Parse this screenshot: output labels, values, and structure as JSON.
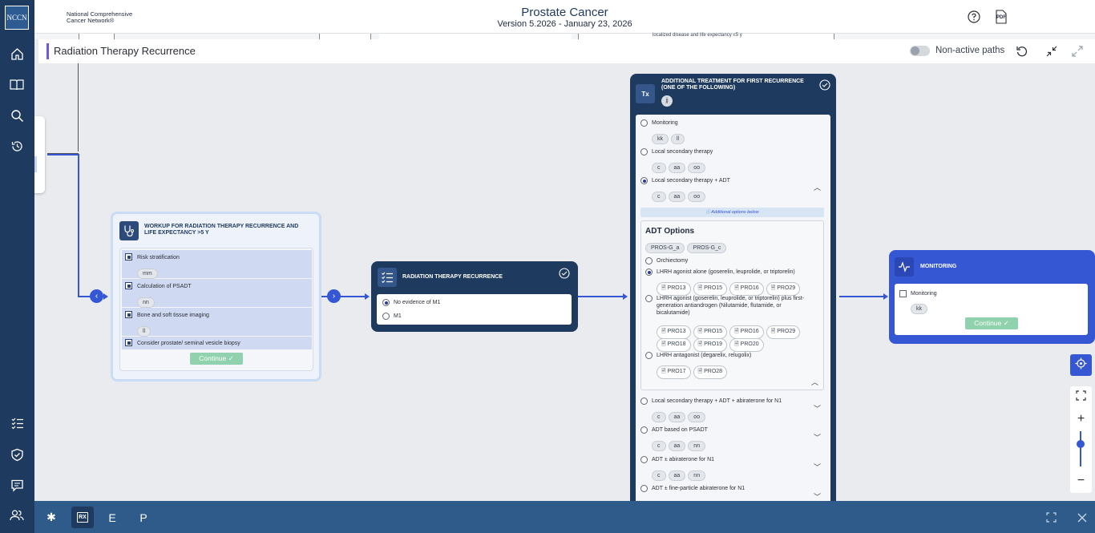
{
  "org": {
    "logo_text": "NCCN",
    "name": "National Comprehensive\nCancer Network®"
  },
  "header": {
    "title": "Prostate Cancer",
    "version": "Version 5.2026 - January 23, 2026",
    "pdf_label": "PDF"
  },
  "background_text": "localized disease and life expectancy ≤5 y",
  "toolbar": {
    "title": "Radiation Therapy Recurrence",
    "nonactive_label": "Non-active paths"
  },
  "workup": {
    "title": "Workup for radiation therapy recurrence and life expectancy >5 y",
    "items": [
      {
        "label": "Risk stratification",
        "chips": [
          "mm"
        ]
      },
      {
        "label": "Calculation of PSADT",
        "chips": [
          "nn"
        ]
      },
      {
        "label": "Bone and soft tissue imaging",
        "chips": [
          "ll"
        ]
      },
      {
        "label": "Consider prostate/ seminal vesicle biopsy",
        "chips": []
      }
    ],
    "continue_label": "Continue ✓"
  },
  "rtr": {
    "title": "Radiation therapy recurrence",
    "options": [
      {
        "label": "No evidence of M1",
        "selected": true
      },
      {
        "label": "M1",
        "selected": false
      }
    ]
  },
  "additional": {
    "title": "Additional treatment for first recurrence (one of the following)",
    "badge": "jj",
    "options": [
      {
        "label": "Monitoring",
        "chips": [
          "kk",
          "ll"
        ]
      },
      {
        "label": "Local secondary therapy",
        "chips": [
          "c",
          "aa",
          "oo"
        ]
      },
      {
        "label": "Local secondary therapy + ADT",
        "chips": [
          "c",
          "aa",
          "oo"
        ]
      }
    ],
    "notice": "Additional options below",
    "adt": {
      "title": "ADT Options",
      "chips": [
        "PROS-G_a",
        "PROS-G_c"
      ],
      "options": [
        {
          "label": "Orchiectomy"
        },
        {
          "label": "LHRH agonist alone (goserelin, leuprolide, or triptorelin)",
          "docs": [
            "PRO13",
            "PRO15",
            "PRO16",
            "PRO29"
          ]
        },
        {
          "label": "LHRH agonist (goserelin, leuprolide, or triptorelin) plus first-generation antiandrogen (Nilutamide, flutamide, or bicalutamide)",
          "docs": [
            "PRO13",
            "PRO15",
            "PRO16",
            "PRO29",
            "PRO18",
            "PRO19",
            "PRO20"
          ]
        },
        {
          "label": "LHRH antagonist (degarelix, relugolix)",
          "docs": [
            "PRO17",
            "PRO28"
          ]
        }
      ]
    },
    "more": [
      {
        "label": "Local secondary therapy + ADT + abiraterone for N1",
        "chips": [
          "c",
          "aa",
          "oo"
        ]
      },
      {
        "label": "ADT based on PSADT",
        "chips": [
          "c",
          "aa",
          "nn"
        ]
      },
      {
        "label": "ADT ± abiraterone for N1",
        "chips": [
          "c",
          "aa",
          "nn"
        ]
      },
      {
        "label": "ADT ± fine-particle abiraterone for N1",
        "chips": []
      }
    ]
  },
  "monitoring": {
    "title": "Monitoring",
    "option": "Monitoring",
    "chip": "kk",
    "continue_label": "Continue ✓"
  },
  "bottom": {
    "items": [
      "RX",
      "E",
      "P"
    ]
  },
  "colors": {
    "sidebar": "#1e3a5f",
    "accent": "#3557d4",
    "card_dark": "#1e3a5f",
    "continue": "#8fd2ad"
  }
}
